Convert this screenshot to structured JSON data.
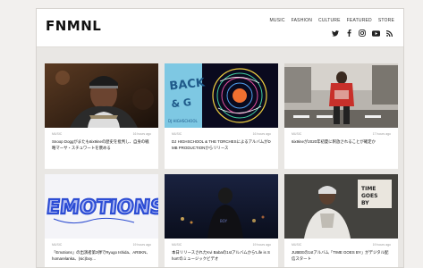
{
  "site": {
    "logo": "FNMNL"
  },
  "nav": [
    "MUSIC",
    "FASHION",
    "CULTURE",
    "FEATURED",
    "STORE"
  ],
  "social_icons": [
    {
      "name": "twitter-icon",
      "glyph": "🐦"
    },
    {
      "name": "facebook-icon",
      "glyph": "f"
    },
    {
      "name": "instagram-icon",
      "glyph": "◎"
    },
    {
      "name": "youtube-icon",
      "glyph": "▶"
    },
    {
      "name": "rss-icon",
      "glyph": "◉"
    }
  ],
  "cards": [
    {
      "category": "MUSIC",
      "time": "16 hours ago",
      "title": "Snoop Doggがまたも6ix9ineの歴史を批判し、自身の戦略マーサ・スチュワートを褒める",
      "image": "snoop"
    },
    {
      "category": "MUSIC",
      "time": "16 hours ago",
      "title": "DJ HIGHSCHOOL & THE TORCHESによるアルバムがDMB PRODUCTIONからリリース",
      "image": "back"
    },
    {
      "category": "MUSIC",
      "time": "17 hours ago",
      "title": "6ix9ineが2020年初夏に釈放されることが確定か",
      "image": "street"
    },
    {
      "category": "MUSIC",
      "time": "19 hours ago",
      "title": "「Emotions」の出演者第3弾でRyugo Ishida、ARSKN、homarelanka、(sic)boy…",
      "image": "emotions"
    },
    {
      "category": "MUSIC",
      "time": "19 hours ago",
      "title": "本日リリースされたKvi Babaの1stアルバムから'Life is Short'のミュージックビデオ",
      "image": "night"
    },
    {
      "category": "MUSIC",
      "time": "19 hours ago",
      "title": "JUBEEの1stアルバム「TIME GOES BY」がデジタル配信スタート",
      "image": "time"
    }
  ]
}
